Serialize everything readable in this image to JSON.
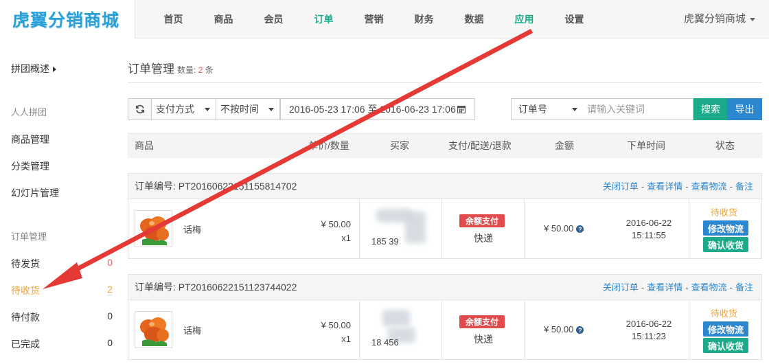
{
  "brand": {
    "logo_text": "虎翼分销商城"
  },
  "nav": {
    "items": [
      "首页",
      "商品",
      "会员",
      "订单",
      "营销",
      "财务",
      "数据",
      "应用",
      "设置"
    ],
    "shop_name": "虎翼分销商城"
  },
  "sidebar": {
    "overview": "拼团概述",
    "group1_title": "人人拼团",
    "group1_items": [
      "商品管理",
      "分类管理",
      "幻灯片管理"
    ],
    "group2_title": "订单管理",
    "orders": [
      {
        "label": "待发货",
        "count": "0"
      },
      {
        "label": "待收货",
        "count": "2"
      },
      {
        "label": "待付款",
        "count": "0"
      },
      {
        "label": "已完成",
        "count": "0"
      }
    ]
  },
  "page": {
    "title": "订单管理",
    "count_prefix": "数量:",
    "count_value": "2",
    "count_suffix": "条"
  },
  "filters": {
    "payment": "支付方式",
    "time": "不按时间",
    "date_range": "2016-05-23 17:06 至 2016-06-23 17:06",
    "keyword_type": "订单号",
    "keyword_placeholder": "请输入关键词",
    "search_label": "搜索",
    "export_label": "导出"
  },
  "table": {
    "headers": [
      "商品",
      "单价/数量",
      "买家",
      "支付/配送/退款",
      "金额",
      "下单时间",
      "状态"
    ]
  },
  "order_actions": {
    "close": "关闭订单",
    "detail": "查看详情",
    "logistics": "查看物流",
    "remark": "备注",
    "sep": "-"
  },
  "orders": [
    {
      "order_no": "订单编号: PT20160622151155814702",
      "goods_name": "话梅",
      "price": "¥ 50.00",
      "qty": "x1",
      "buyer_phone": "185   39",
      "pay_badge": "余额支付",
      "shipping": "快递",
      "amount": "¥ 50.00",
      "date": "2016-06-22",
      "time": "15:11:55",
      "status": "待收货",
      "modify_label": "修改物流",
      "confirm_label": "确认收货"
    },
    {
      "order_no": "订单编号: PT20160622151123744022",
      "goods_name": "话梅",
      "price": "¥ 50.00",
      "qty": "x1",
      "buyer_phone": "18    456",
      "pay_badge": "余额支付",
      "shipping": "快递",
      "amount": "¥ 50.00",
      "date": "2016-06-22",
      "time": "15:11:23",
      "status": "待收货",
      "modify_label": "修改物流",
      "confirm_label": "确认收货"
    }
  ],
  "colors": {
    "accent_green": "#1bab8a",
    "accent_blue": "#2b87cf",
    "pending_orange": "#f0a43c",
    "badge_red": "#e24b4b",
    "arrow_red": "#e53935"
  }
}
